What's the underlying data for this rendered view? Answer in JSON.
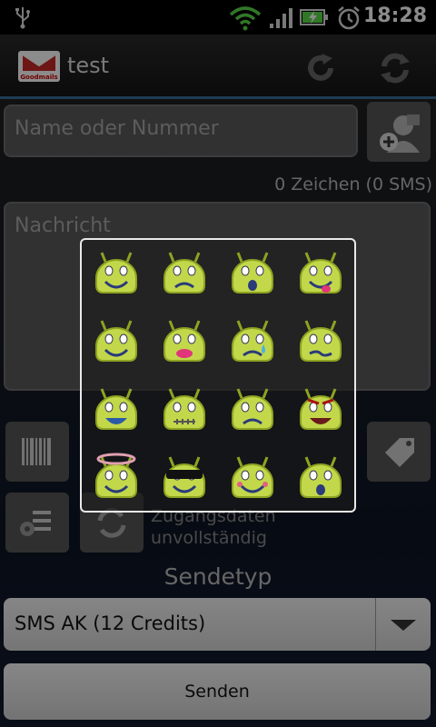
{
  "status": {
    "time": "18:28"
  },
  "app": {
    "title": "test",
    "logo_text": "Goodmails"
  },
  "recipient": {
    "placeholder": "Name oder Nummer"
  },
  "counter": "0 Zeichen (0 SMS)",
  "message": {
    "placeholder": "Nachricht"
  },
  "hint": {
    "line1": "Zugangsdaten",
    "line2": "unvollständig"
  },
  "sendetyp": {
    "label": "Sendetyp",
    "selected": "SMS AK (12 Credits)"
  },
  "send_button": "Senden",
  "colors": {
    "accent": "#3b6e9c",
    "emoticon": "#c2d84a",
    "emoticon_dark": "#8ea322"
  },
  "emoticons": [
    "smile",
    "sad",
    "surprised",
    "tongue",
    "wink",
    "kiss",
    "cry",
    "undecided",
    "laugh",
    "sealed",
    "confused",
    "angry",
    "angel",
    "cool",
    "embarrassed",
    "wonder"
  ]
}
